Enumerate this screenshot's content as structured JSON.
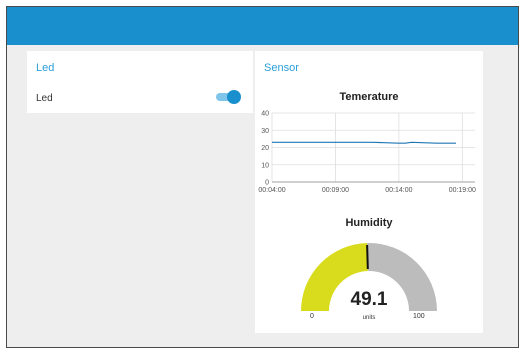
{
  "led_card": {
    "title": "Led",
    "switch_label": "Led",
    "switch_on": true
  },
  "sensor_card": {
    "title": "Sensor",
    "temperature_title": "Temerature",
    "humidity_title": "Humidity",
    "gauge": {
      "value": 49.1,
      "value_text": "49.1",
      "units": "units",
      "min": 0,
      "max": 100,
      "min_label": "0",
      "max_label": "100"
    }
  },
  "colors": {
    "header": "#1a8fce",
    "accent": "#2b9fd9",
    "line": "#1f77b4",
    "gauge_fill": "#d8dc1c",
    "gauge_track": "#bcbcbc"
  },
  "chart_data": {
    "type": "line",
    "title": "Temerature",
    "xlabel": "",
    "ylabel": "",
    "ylim": [
      0,
      40
    ],
    "xlim": [
      "00:04:00",
      "00:20:00"
    ],
    "y_ticks": [
      0,
      10,
      20,
      30,
      40
    ],
    "x_ticks": [
      "00:04:00",
      "00:09:00",
      "00:14:00",
      "00:19:00"
    ],
    "grid": true,
    "series": [
      {
        "x": [
          "00:04:00",
          "00:12:00",
          "00:14:00",
          "00:14:30",
          "00:15:00",
          "00:17:00",
          "00:18:30"
        ],
        "y": [
          23,
          23,
          22.5,
          22.5,
          23,
          22.5,
          22.5
        ]
      }
    ]
  }
}
